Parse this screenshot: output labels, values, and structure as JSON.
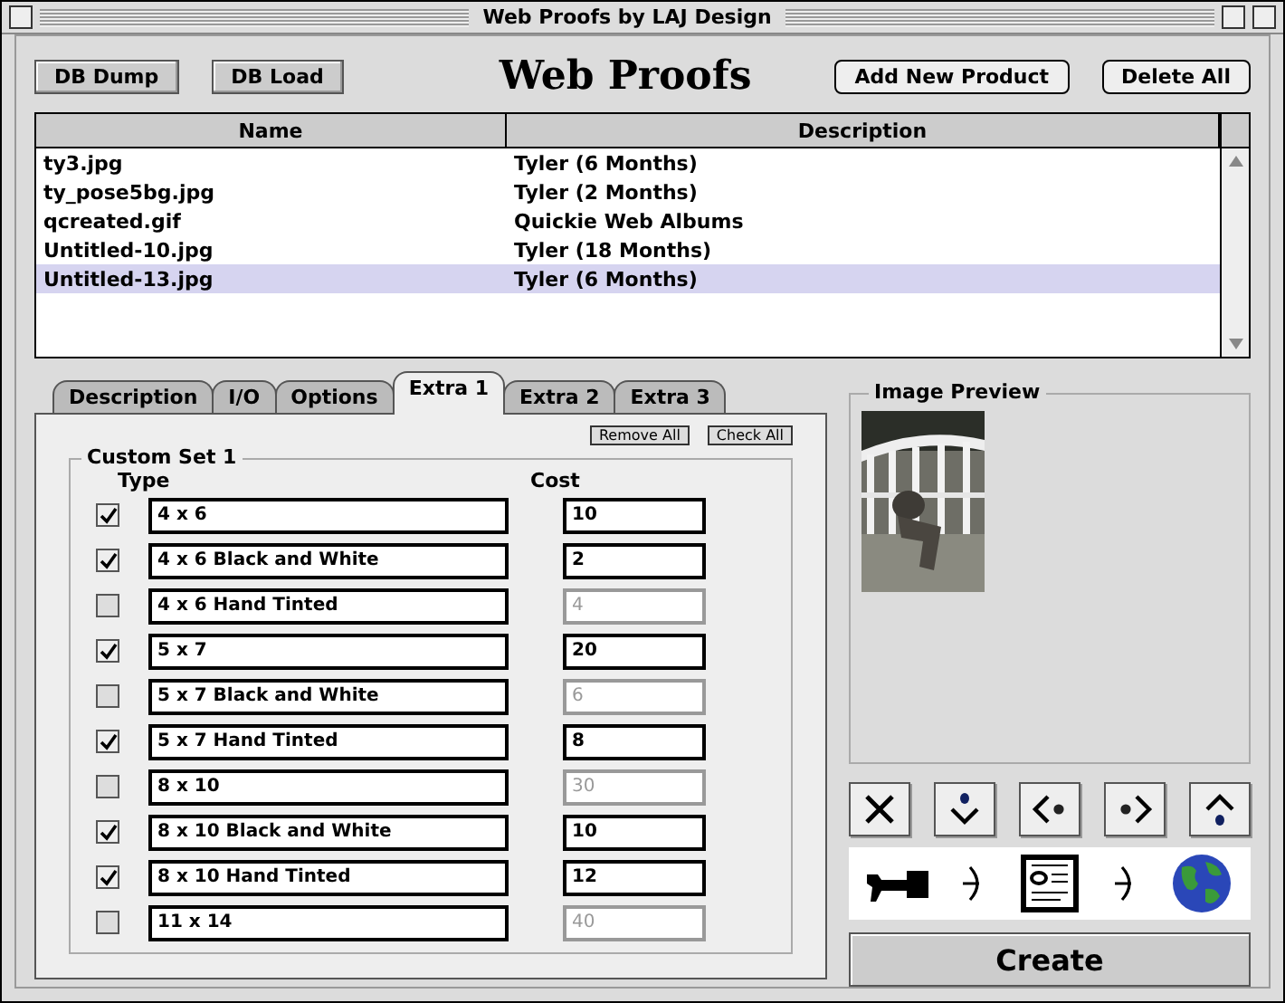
{
  "window": {
    "title": "Web Proofs by LAJ Design"
  },
  "toolbar": {
    "left_buttons": [
      "DB Dump",
      "DB Load"
    ],
    "logo": "Web Proofs",
    "right_buttons": [
      "Add New Product",
      "Delete All"
    ]
  },
  "table": {
    "columns": [
      "Name",
      "Description"
    ],
    "rows": [
      {
        "name": "ty3.jpg",
        "description": "Tyler (6 Months)",
        "selected": false
      },
      {
        "name": "ty_pose5bg.jpg",
        "description": "Tyler (2 Months)",
        "selected": false
      },
      {
        "name": "qcreated.gif",
        "description": "Quickie Web Albums",
        "selected": false
      },
      {
        "name": "Untitled-10.jpg",
        "description": "Tyler (18 Months)",
        "selected": false
      },
      {
        "name": "Untitled-13.jpg",
        "description": "Tyler (6 Months)",
        "selected": true
      }
    ]
  },
  "tabs": [
    {
      "label": "Description",
      "selected": false
    },
    {
      "label": "I/O",
      "selected": false
    },
    {
      "label": "Options",
      "selected": false
    },
    {
      "label": "Extra 1",
      "selected": true
    },
    {
      "label": "Extra 2",
      "selected": false
    },
    {
      "label": "Extra 3",
      "selected": false
    }
  ],
  "panel": {
    "buttons": [
      "Remove All",
      "Check All"
    ],
    "group_title": "Custom Set 1",
    "type_heading": "Type",
    "cost_heading": "Cost",
    "items": [
      {
        "checked": true,
        "type": "4 x 6",
        "cost": "10"
      },
      {
        "checked": true,
        "type": "4 x 6 Black and White",
        "cost": "2"
      },
      {
        "checked": false,
        "type": "4 x 6 Hand Tinted",
        "cost": "4"
      },
      {
        "checked": true,
        "type": "5 x 7",
        "cost": "20"
      },
      {
        "checked": false,
        "type": "5 x 7 Black and White",
        "cost": "6"
      },
      {
        "checked": true,
        "type": "5 x 7 Hand Tinted",
        "cost": "8"
      },
      {
        "checked": false,
        "type": "8 x 10",
        "cost": "30"
      },
      {
        "checked": true,
        "type": "8 x 10 Black and White",
        "cost": "10"
      },
      {
        "checked": true,
        "type": "8 x 10 Hand Tinted",
        "cost": "12"
      },
      {
        "checked": false,
        "type": "11 x 14",
        "cost": "40"
      }
    ]
  },
  "preview": {
    "title": "Image Preview"
  },
  "create_button": "Create"
}
